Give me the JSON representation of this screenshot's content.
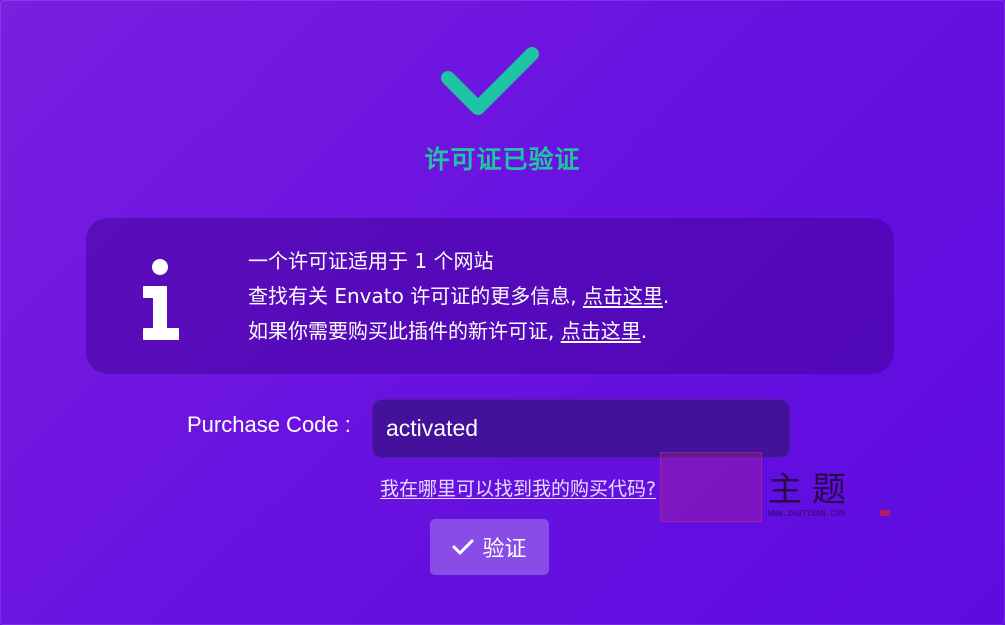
{
  "status": {
    "title": "许可证已验证",
    "check_color": "#1fc4a4",
    "icon": "checkmark-icon"
  },
  "info": {
    "icon": "info-icon",
    "line1": "一个许可证适用于 1 个网站",
    "line2_prefix": "查找有关 Envato 许可证的更多信息, ",
    "line2_link": "点击这里",
    "line2_suffix": ".",
    "line3_prefix": "如果你需要购买此插件的新许可证, ",
    "line3_link": "点击这里",
    "line3_suffix": "."
  },
  "purchase": {
    "label": "Purchase Code :",
    "value": "activated",
    "help_link": "我在哪里可以找到我的购买代码?"
  },
  "verify_button": {
    "label": "验证",
    "icon": "check-icon",
    "color": "#8a4ce9"
  },
  "watermark": {
    "text": "主题",
    "sub": "WWW.ZHUTIBAN.COM"
  }
}
